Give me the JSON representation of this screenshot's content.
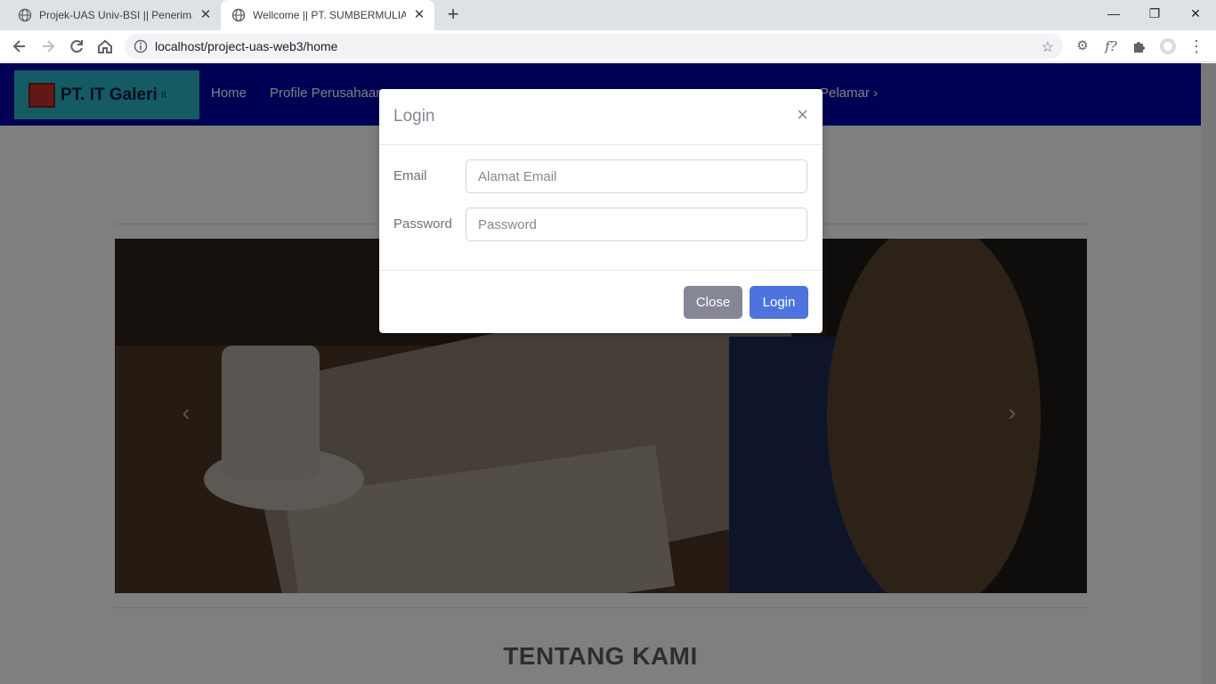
{
  "browser": {
    "tabs": [
      {
        "title": "Projek-UAS Univ-BSI || Penerimaan",
        "active": false
      },
      {
        "title": "Wellcome || PT. SUMBERMULIA H",
        "active": true
      }
    ],
    "new_tab": "+",
    "url": "localhost/project-uas-web3/home",
    "window_controls": {
      "minimize": "—",
      "maximize": "❐",
      "close": "✕"
    },
    "icons": {
      "back": "back-arrow-icon",
      "forward": "forward-arrow-icon",
      "reload": "reload-icon",
      "home": "home-icon",
      "star": "star-icon",
      "extensions": "puzzle-icon",
      "menu": "kebab-menu-icon"
    },
    "extension_label": "f?"
  },
  "navbar": {
    "brand": "PT. IT Galeri",
    "brand_sup": "II",
    "links": [
      "Home",
      "Profile Perusahaan"
    ],
    "right_link": "Pelamar",
    "color": "#0000a8",
    "brand_bg": "#2ab7c9"
  },
  "main": {
    "section_title": "TENTANG KAMI"
  },
  "modal": {
    "title": "Login",
    "close_symbol": "×",
    "email_label": "Email",
    "email_placeholder": "Alamat Email",
    "password_label": "Password",
    "password_placeholder": "Password",
    "close_button": "Close",
    "login_button": "Login",
    "colors": {
      "primary": "#4e73df",
      "secondary": "#858796"
    }
  }
}
